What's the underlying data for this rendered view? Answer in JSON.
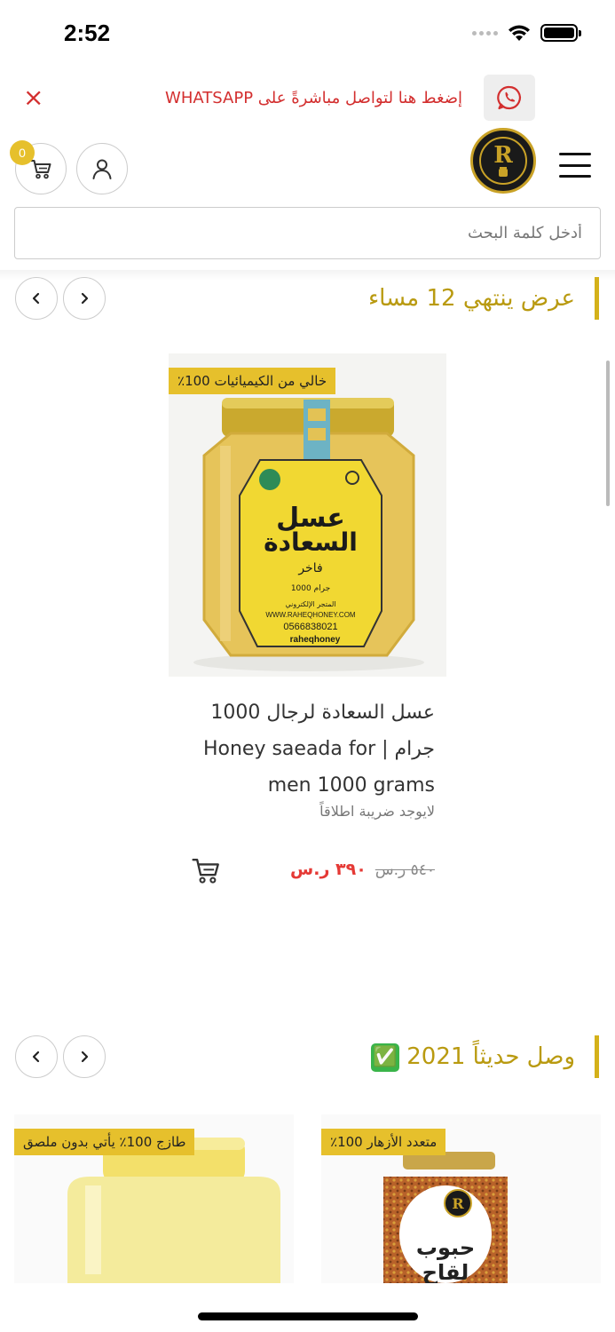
{
  "status_bar": {
    "time": "2:52"
  },
  "whatsapp_banner": {
    "text": "إضغط هنا لتواصل مباشرةً على WHATSAPP",
    "close_symbol": "×"
  },
  "header": {
    "cart_count": "0",
    "logo_letter": "R"
  },
  "search": {
    "placeholder": "أدخل كلمة البحث"
  },
  "sections": [
    {
      "title": "عرض ينتهي 12 مساء",
      "products": [
        {
          "badge": "خالي من الكيميائيات 100٪",
          "jar_brand": "عسل",
          "jar_name": "السعادة",
          "jar_sub": "فاخر",
          "jar_weight": "1000 جرام",
          "jar_store": "المتجر الإلكتروني",
          "jar_site": "WWW.RAHEQHONEY.COM",
          "jar_phone": "0566838021",
          "jar_handle": "raheqhoney",
          "title": "عسل السعادة لرجال 1000 جرام | Honey saeada for men 1000 grams",
          "tax_note": "لايوجد ضريبة اطلاقاً",
          "old_price": "٥٤٠ ر.س",
          "new_price": "٣٩٠ ر.س"
        }
      ]
    },
    {
      "title": "وصل حديثاً 2021",
      "title_emoji": "✅",
      "products": [
        {
          "badge": "متعدد الأزهار 100٪",
          "jar_name": "حبوب",
          "jar_name_2": "لقاح"
        },
        {
          "badge": "طازج 100٪ يأتي بدون ملصق"
        }
      ]
    }
  ],
  "colors": {
    "accent_gold": "#d4b11a",
    "title_gold": "#b99a10",
    "badge_yellow": "#e6c02c",
    "banner_red": "#d32f2f",
    "sale_red": "#e53935"
  }
}
